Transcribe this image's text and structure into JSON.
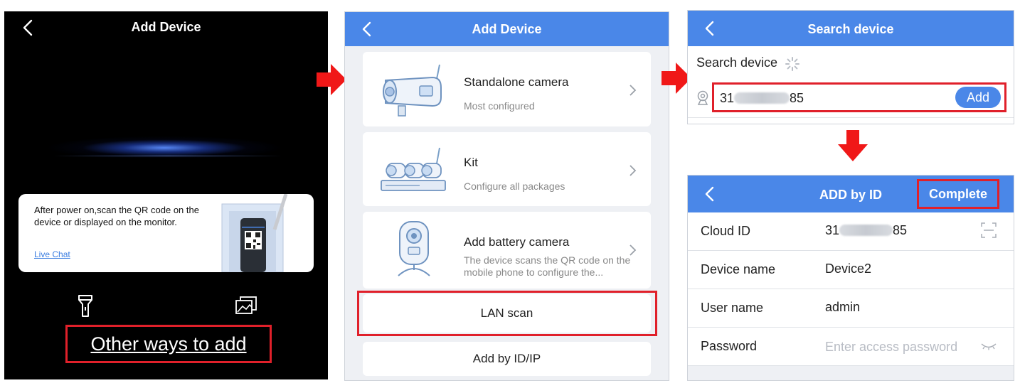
{
  "panel_scan": {
    "title": "Add Device",
    "instruction": "After power on,scan the QR code on the device or displayed on the monitor.",
    "live_chat": "Live Chat",
    "other_ways": "Other ways to add",
    "icons": [
      "back-arrow-icon",
      "flashlight-icon",
      "album-icon",
      "qr-code-icon"
    ]
  },
  "panel_add_device": {
    "title": "Add Device",
    "options": [
      {
        "name": "Standalone camera",
        "desc": "Most configured",
        "icon": "bullet-camera-icon"
      },
      {
        "name": "Kit",
        "desc": "Configure all packages",
        "icon": "nvr-kit-icon"
      },
      {
        "name": "Add battery camera",
        "desc": "The device scans the QR code on the mobile phone to configure the...",
        "icon": "battery-camera-icon"
      }
    ],
    "lan_scan": "LAN scan",
    "add_by_id_ip": "Add by ID/IP"
  },
  "panel_search": {
    "title": "Search device",
    "label": "Search device",
    "device_id_start": "31",
    "device_id_end": "85",
    "add_button": "Add"
  },
  "panel_add_by_id": {
    "title": "ADD by ID",
    "complete": "Complete",
    "fields": {
      "cloud_id_label": "Cloud ID",
      "cloud_id_start": "31",
      "cloud_id_end": "85",
      "device_name_label": "Device name",
      "device_name_value": "Device2",
      "user_name_label": "User name",
      "user_name_value": "admin",
      "password_label": "Password",
      "password_placeholder": "Enter access password"
    }
  },
  "colors": {
    "accent": "#4a87e8",
    "highlight": "#e0202a",
    "arrow": "#f01818"
  }
}
